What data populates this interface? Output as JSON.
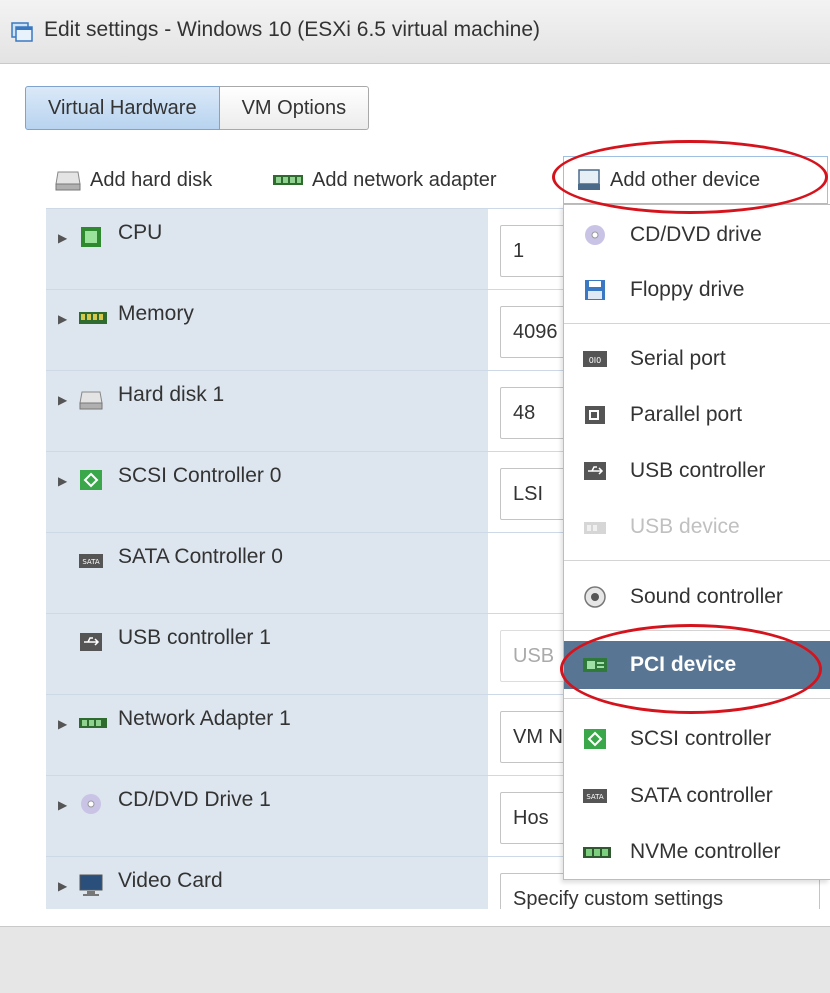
{
  "window": {
    "title": "Edit settings - Windows 10 (ESXi 6.5 virtual machine)",
    "icon": "edit-settings-icon"
  },
  "tabs": [
    {
      "label": "Virtual Hardware",
      "active": true
    },
    {
      "label": "VM Options",
      "active": false
    }
  ],
  "toolbar": {
    "add_hard_disk": "Add hard disk",
    "add_network_adapter": "Add network adapter",
    "add_other_device": "Add other device"
  },
  "hardware": [
    {
      "name": "CPU",
      "value": "1",
      "icon": "cpu-icon",
      "expandable": true
    },
    {
      "name": "Memory",
      "value": "4096",
      "icon": "memory-icon",
      "expandable": true
    },
    {
      "name": "Hard disk 1",
      "value": "48",
      "icon": "hard-disk-icon",
      "expandable": true
    },
    {
      "name": "SCSI Controller 0",
      "value": "LSI",
      "icon": "scsi-icon",
      "expandable": true
    },
    {
      "name": "SATA Controller 0",
      "value": "",
      "icon": "sata-icon",
      "expandable": false
    },
    {
      "name": "USB controller 1",
      "value": "USB",
      "icon": "usb-icon",
      "expandable": false
    },
    {
      "name": "Network Adapter 1",
      "value": "VM N",
      "icon": "network-adapter-icon",
      "expandable": true
    },
    {
      "name": "CD/DVD Drive 1",
      "value": "Hos",
      "icon": "cd-dvd-icon",
      "expandable": true
    },
    {
      "name": "Video Card",
      "value": "Specify custom settings",
      "icon": "video-card-icon",
      "expandable": true
    }
  ],
  "menu": {
    "items": [
      {
        "label": "CD/DVD drive",
        "icon": "cd-dvd-icon",
        "disabled": false
      },
      {
        "label": "Floppy drive",
        "icon": "floppy-icon",
        "disabled": false
      },
      {
        "label": "Serial port",
        "icon": "serial-port-icon",
        "disabled": false
      },
      {
        "label": "Parallel port",
        "icon": "parallel-port-icon",
        "disabled": false
      },
      {
        "label": "USB controller",
        "icon": "usb-icon",
        "disabled": false
      },
      {
        "label": "USB device",
        "icon": "usb-device-icon",
        "disabled": true
      },
      {
        "label": "Sound controller",
        "icon": "sound-icon",
        "disabled": false
      },
      {
        "label": "PCI device",
        "icon": "pci-device-icon",
        "disabled": false,
        "selected": true
      },
      {
        "label": "SCSI controller",
        "icon": "scsi-icon",
        "disabled": false
      },
      {
        "label": "SATA controller",
        "icon": "sata-icon",
        "disabled": false
      },
      {
        "label": "NVMe controller",
        "icon": "nvme-icon",
        "disabled": false
      }
    ]
  },
  "colors": {
    "annotation": "#d5131c",
    "menu_selected": "#587693",
    "row_label_bg": "#dde6ef"
  }
}
